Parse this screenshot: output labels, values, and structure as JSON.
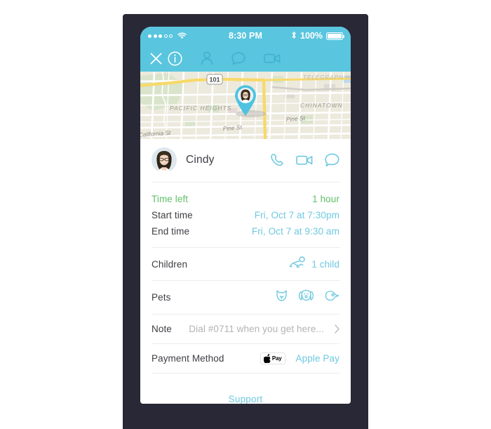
{
  "status_bar": {
    "signal_dots_filled": 3,
    "signal_dots_total": 5,
    "wifi_icon": "wifi-icon",
    "time": "8:30 PM",
    "bluetooth_icon": "bluetooth-icon",
    "battery_percent": "100%",
    "battery_icon": "battery-full-icon"
  },
  "nav_bar": {
    "close_icon": "close-icon",
    "items": [
      {
        "icon": "info-circle-icon",
        "name": "tab-info",
        "active": true
      },
      {
        "icon": "person-icon",
        "name": "tab-profile",
        "active": false
      },
      {
        "icon": "chat-bubble-icon",
        "name": "tab-chat",
        "active": false
      },
      {
        "icon": "video-camera-icon",
        "name": "tab-video",
        "active": false
      }
    ]
  },
  "map": {
    "route_shield": "101",
    "labels": [
      "PACIFIC HEIGHTS",
      "CHINATOWN",
      "TELEGRAPH HILL",
      "Pine St",
      "Pine St",
      "California St"
    ],
    "pin_icon": "map-pin-avatar-icon"
  },
  "profile": {
    "name": "Cindy",
    "avatar_icon": "avatar-photo",
    "actions": [
      {
        "icon": "phone-icon",
        "name": "call-button"
      },
      {
        "icon": "video-camera-icon",
        "name": "video-call-button"
      },
      {
        "icon": "chat-bubble-icon",
        "name": "message-button"
      }
    ]
  },
  "details": {
    "time_left": {
      "label": "Time left",
      "value": "1 hour"
    },
    "start_time": {
      "label": "Start time",
      "value": "Fri, Oct 7 at 7:30pm"
    },
    "end_time": {
      "label": "End time",
      "value": "Fri, Oct 7 at 9:30 am"
    },
    "children": {
      "label": "Children",
      "value": "1 child",
      "icon": "baby-crawling-icon"
    },
    "pets": {
      "label": "Pets",
      "icons": [
        {
          "icon": "cat-icon",
          "name": "pet-cat-icon"
        },
        {
          "icon": "dog-icon",
          "name": "pet-dog-icon"
        },
        {
          "icon": "bird-icon",
          "name": "pet-bird-icon"
        }
      ]
    },
    "note": {
      "label": "Note",
      "value": "Dial #0711 when you get here...",
      "chevron": "chevron-right-icon"
    },
    "payment": {
      "label": "Payment Method",
      "value": "Apple Pay",
      "badge_text": "Pay",
      "badge_icon": "apple-logo-icon"
    }
  },
  "footer": {
    "support_label": "Support"
  },
  "colors": {
    "accent_blue": "#59c5de",
    "light_blue": "#6ec9e0",
    "green": "#62bf6a",
    "text_dark": "#3d3d44",
    "muted": "#b3b3b6",
    "frame": "#282836"
  }
}
